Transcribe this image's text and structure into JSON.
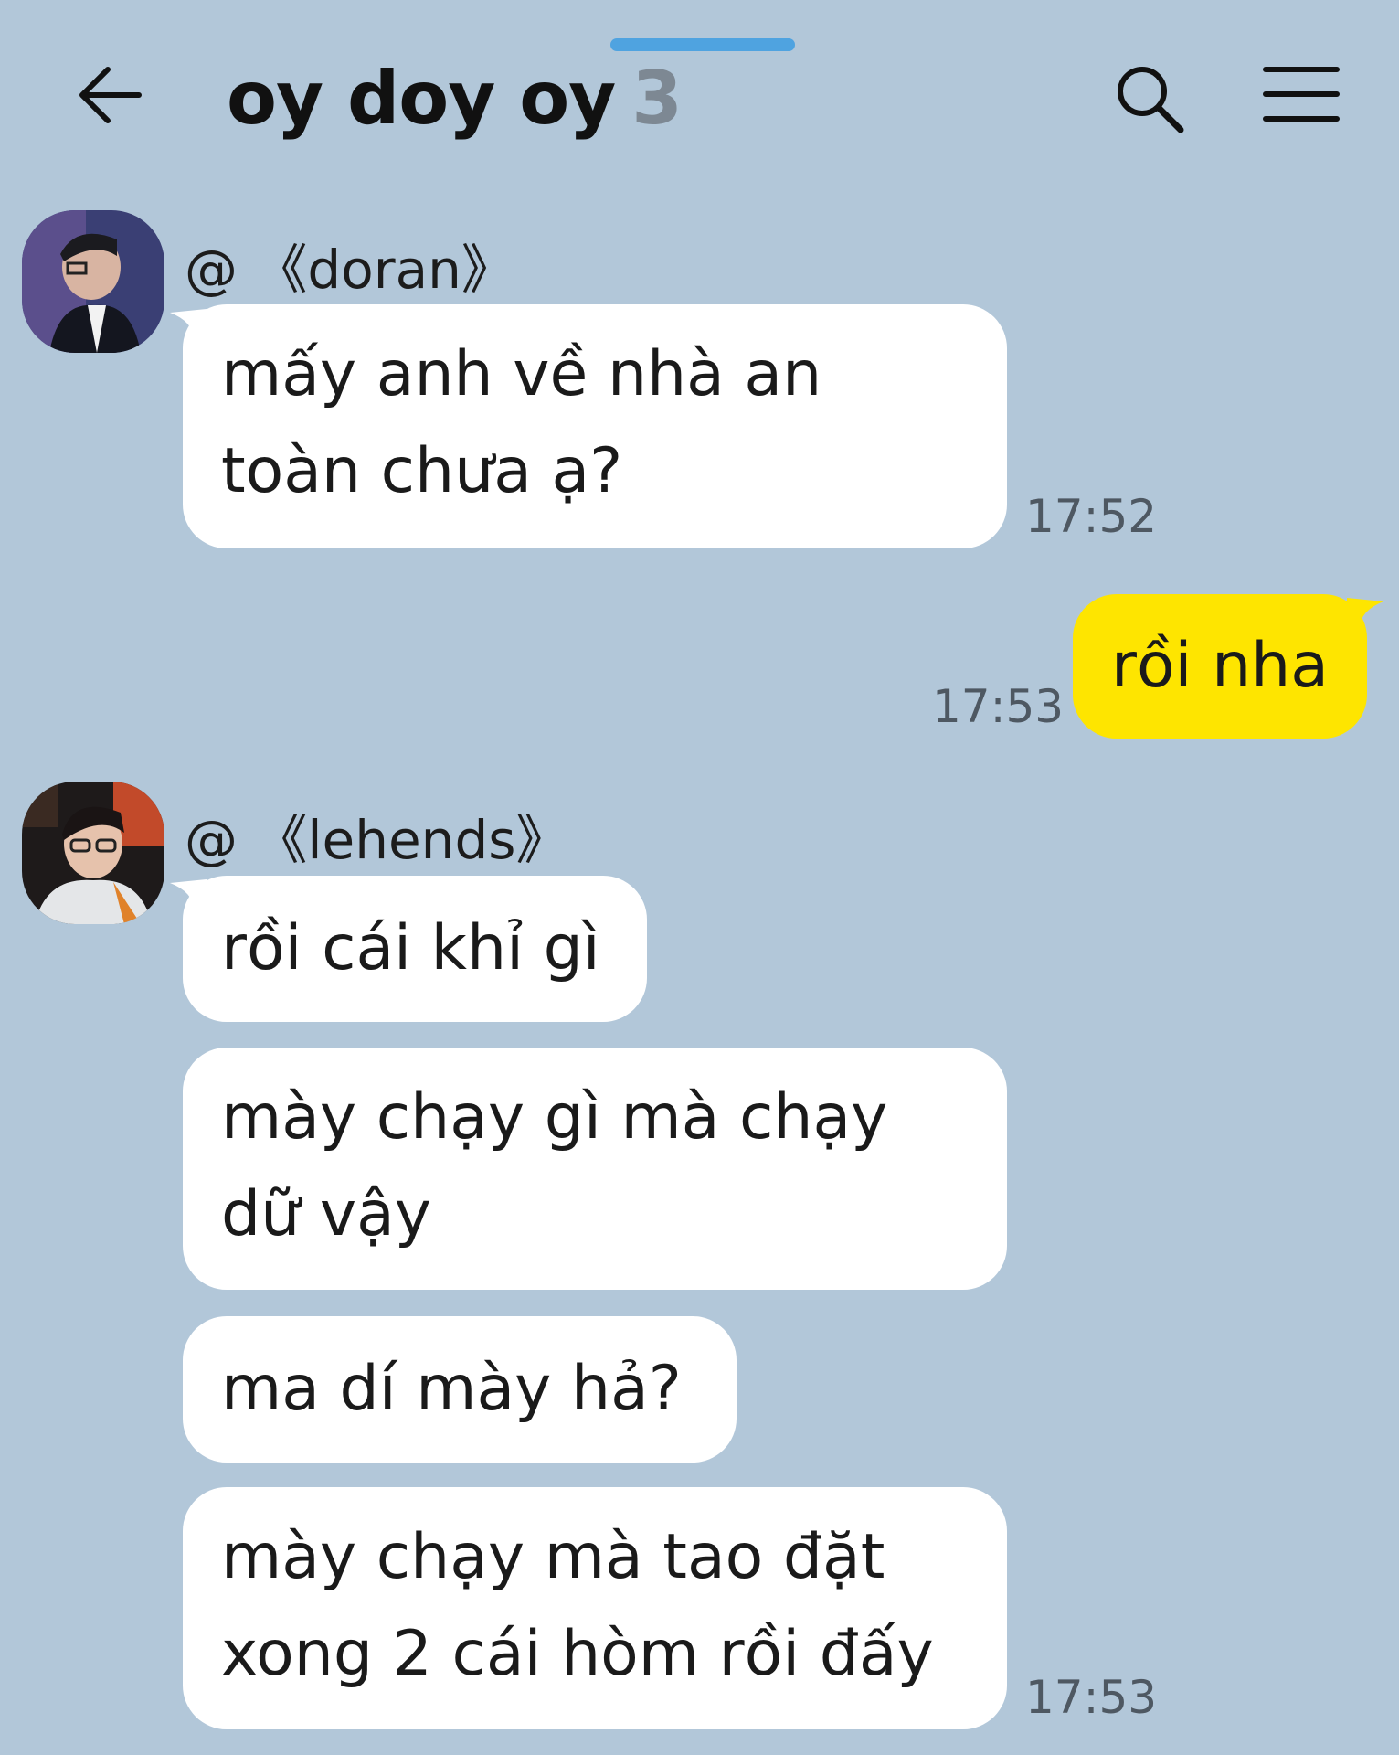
{
  "header": {
    "title": "oy doy oy",
    "member_count": "3",
    "icons": [
      "back-arrow-icon",
      "search-icon",
      "menu-icon"
    ]
  },
  "colors": {
    "background": "#b2c7d9",
    "incoming_bubble": "#ffffff",
    "outgoing_bubble": "#fee500",
    "grab_handle": "#4fa3e0"
  },
  "messages": [
    {
      "sender": "@ 《doran》",
      "lines": [
        "mấy anh về nhà an",
        "toàn chưa ạ?"
      ],
      "time": "17:52"
    },
    {
      "mine": true,
      "lines": [
        "rồi nha"
      ],
      "time": "17:53"
    },
    {
      "sender": "@ 《lehends》",
      "lines": [
        "rồi cái khỉ gì"
      ]
    },
    {
      "lines": [
        "mày chạy gì mà chạy",
        "dữ vậy"
      ]
    },
    {
      "lines": [
        "ma dí mày hả?"
      ]
    },
    {
      "lines": [
        "mày chạy mà tao đặt",
        "xong 2 cái hòm rồi đấy"
      ],
      "time": "17:53"
    }
  ]
}
